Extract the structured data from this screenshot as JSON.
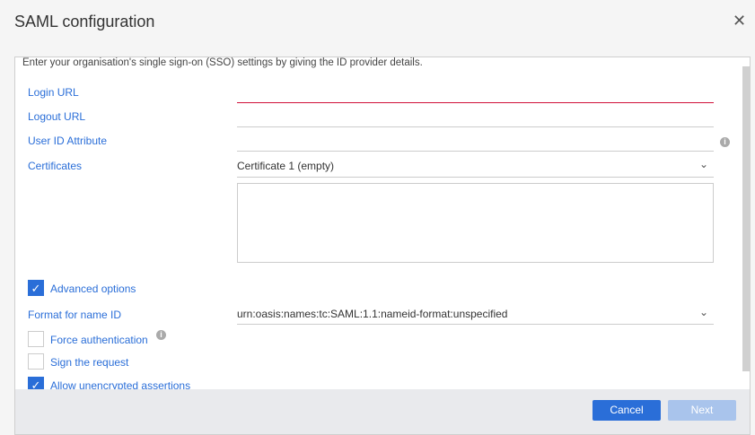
{
  "dialog": {
    "title": "SAML configuration",
    "close_icon": "close-icon"
  },
  "intro": "Enter your organisation's single sign-on (SSO) settings by giving the ID provider details.",
  "fields": {
    "login_url": {
      "label": "Login URL",
      "value": ""
    },
    "logout_url": {
      "label": "Logout URL",
      "value": ""
    },
    "user_id_attribute": {
      "label": "User ID Attribute",
      "value": ""
    },
    "certificates": {
      "label": "Certificates",
      "value": "Certificate 1 (empty)",
      "content": ""
    },
    "format_name_id": {
      "label": "Format for name ID",
      "value": "urn:oasis:names:tc:SAML:1.1:nameid-format:unspecified"
    }
  },
  "checkboxes": {
    "advanced": {
      "label": "Advanced options",
      "checked": true
    },
    "force_auth": {
      "label": "Force authentication",
      "checked": false
    },
    "sign_request": {
      "label": "Sign the request",
      "checked": false
    },
    "allow_unencrypted": {
      "label": "Allow unencrypted assertions",
      "checked": true
    }
  },
  "footer": {
    "cancel": "Cancel",
    "next": "Next"
  },
  "colors": {
    "accent": "#2a6ed8",
    "error": "#d0103a",
    "disabled": "#a9c4ec"
  }
}
